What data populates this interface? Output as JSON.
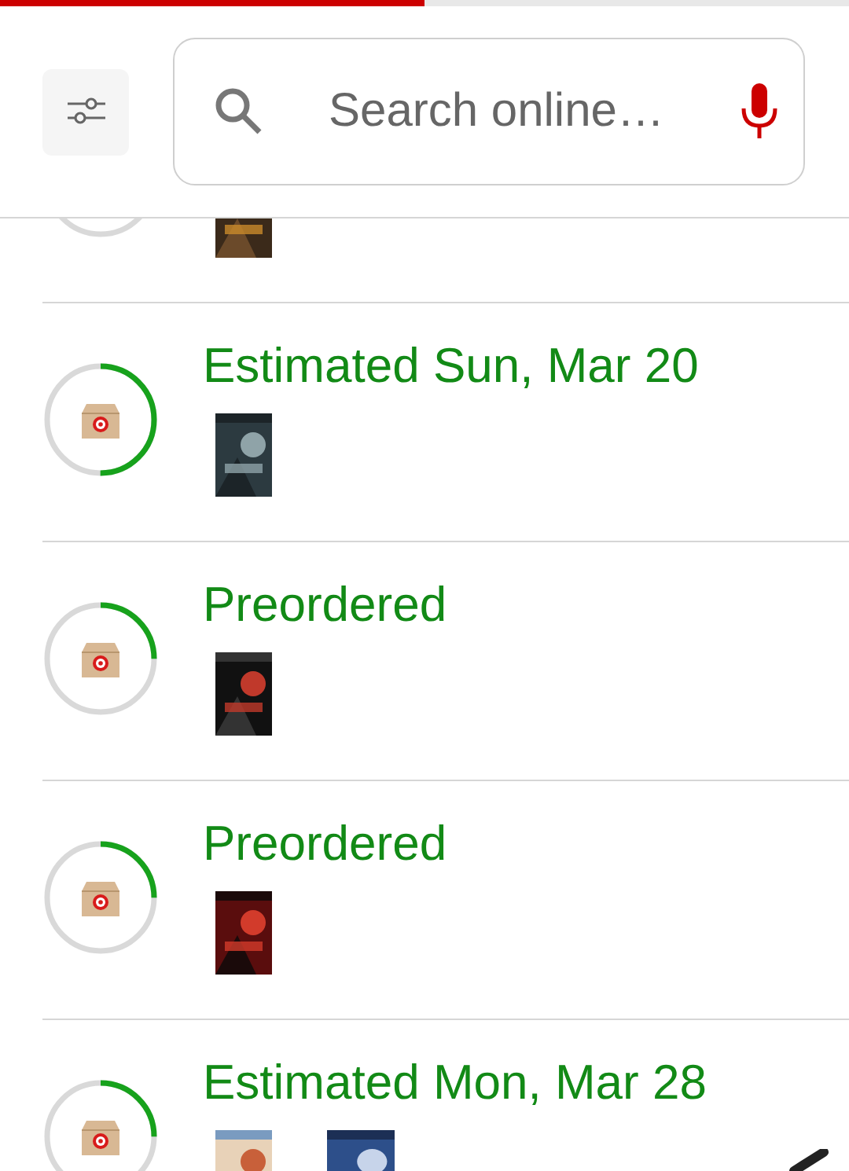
{
  "page_progress": {
    "level": 0.5
  },
  "search": {
    "placeholder": "Search online…"
  },
  "orders": [
    {
      "kind": "ordered"
    },
    {
      "kind": "in_transit",
      "status": "Estimated Sun, Mar 20"
    },
    {
      "kind": "ordered",
      "status": "Preordered"
    },
    {
      "kind": "ordered",
      "status": "Preordered"
    },
    {
      "kind": "ordered",
      "status": "Estimated Mon, Mar 28"
    }
  ]
}
